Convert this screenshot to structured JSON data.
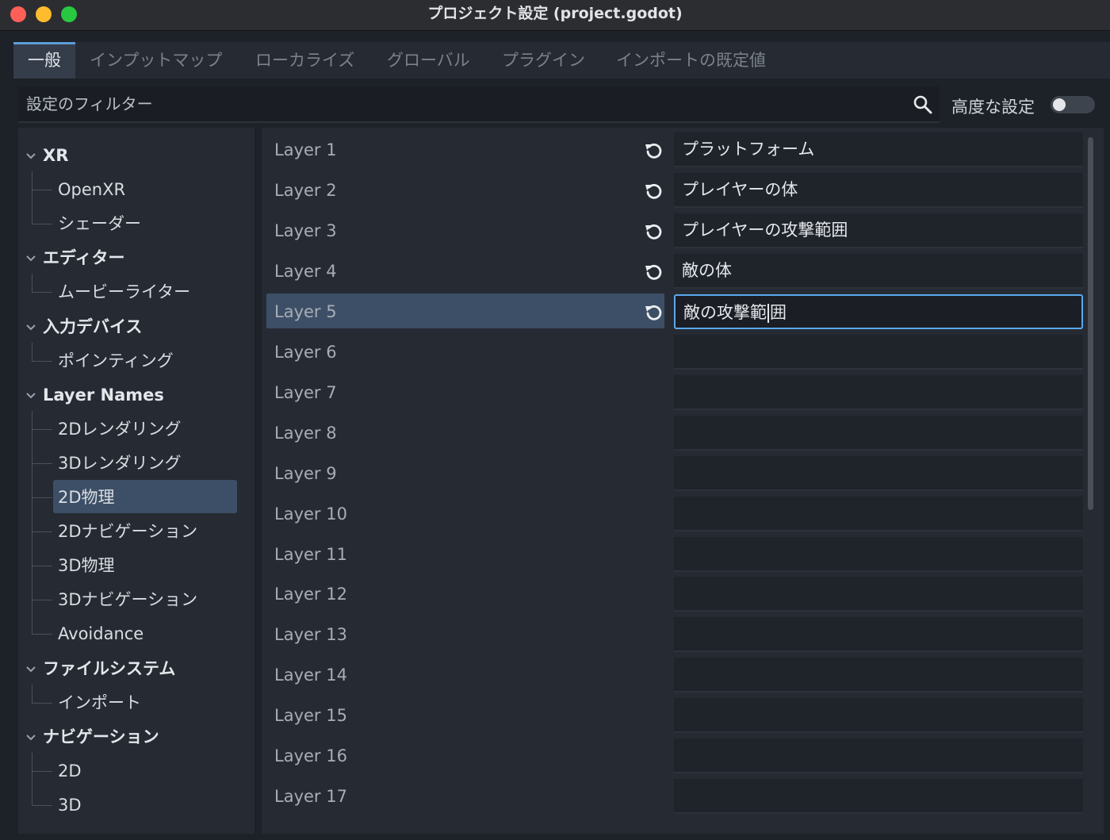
{
  "window": {
    "title": "プロジェクト設定 (project.godot)"
  },
  "tabs": [
    {
      "label": "一般",
      "active": true
    },
    {
      "label": "インプットマップ"
    },
    {
      "label": "ローカライズ"
    },
    {
      "label": "グローバル"
    },
    {
      "label": "プラグイン"
    },
    {
      "label": "インポートの既定値"
    }
  ],
  "filter": {
    "placeholder": "設定のフィルター"
  },
  "advanced": {
    "label": "高度な設定",
    "enabled": false
  },
  "tree": [
    {
      "label": "XR",
      "kind": "category"
    },
    {
      "label": "OpenXR",
      "kind": "child"
    },
    {
      "label": "シェーダー",
      "kind": "child"
    },
    {
      "label": "エディター",
      "kind": "category"
    },
    {
      "label": "ムービーライター",
      "kind": "child"
    },
    {
      "label": "入力デバイス",
      "kind": "category"
    },
    {
      "label": "ポインティング",
      "kind": "child"
    },
    {
      "label": "Layer Names",
      "kind": "category"
    },
    {
      "label": "2Dレンダリング",
      "kind": "child"
    },
    {
      "label": "3Dレンダリング",
      "kind": "child"
    },
    {
      "label": "2D物理",
      "kind": "child",
      "selected": true
    },
    {
      "label": "2Dナビゲーション",
      "kind": "child"
    },
    {
      "label": "3D物理",
      "kind": "child"
    },
    {
      "label": "3Dナビゲーション",
      "kind": "child"
    },
    {
      "label": "Avoidance",
      "kind": "child"
    },
    {
      "label": "ファイルシステム",
      "kind": "category"
    },
    {
      "label": "インポート",
      "kind": "child"
    },
    {
      "label": "ナビゲーション",
      "kind": "category"
    },
    {
      "label": "2D",
      "kind": "child"
    },
    {
      "label": "3D",
      "kind": "child"
    }
  ],
  "layers": [
    {
      "label": "Layer 1",
      "value": "プラットフォーム",
      "modified": true
    },
    {
      "label": "Layer 2",
      "value": "プレイヤーの体",
      "modified": true
    },
    {
      "label": "Layer 3",
      "value": "プレイヤーの攻撃範囲",
      "modified": true
    },
    {
      "label": "Layer 4",
      "value": "敵の体",
      "modified": true
    },
    {
      "label": "Layer 5",
      "value_before_caret": "敵の攻撃範",
      "value_after_caret": "囲",
      "modified": true,
      "selected": true,
      "editing": true
    },
    {
      "label": "Layer 6",
      "value": ""
    },
    {
      "label": "Layer 7",
      "value": ""
    },
    {
      "label": "Layer 8",
      "value": ""
    },
    {
      "label": "Layer 9",
      "value": ""
    },
    {
      "label": "Layer 10",
      "value": ""
    },
    {
      "label": "Layer 11",
      "value": ""
    },
    {
      "label": "Layer 12",
      "value": ""
    },
    {
      "label": "Layer 13",
      "value": ""
    },
    {
      "label": "Layer 14",
      "value": ""
    },
    {
      "label": "Layer 15",
      "value": ""
    },
    {
      "label": "Layer 16",
      "value": ""
    },
    {
      "label": "Layer 17",
      "value": ""
    }
  ],
  "icons": {
    "search": "search-icon",
    "revert": "revert-icon",
    "chevron": "chevron-down-icon"
  },
  "colors": {
    "accent": "#5aa8f0",
    "selection": "#3d4f66",
    "tab_underline": "#5d9dd8"
  }
}
